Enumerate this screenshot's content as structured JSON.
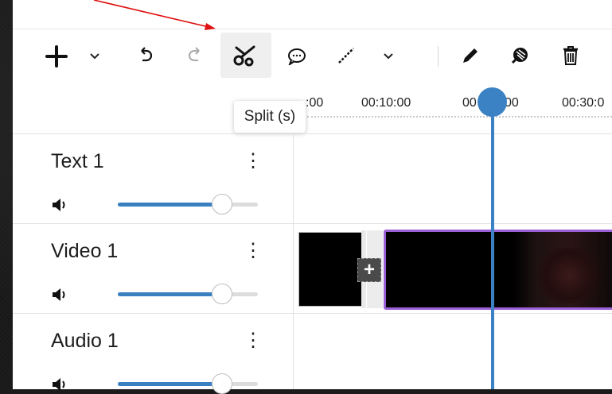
{
  "toolbar": {
    "tools": [
      {
        "name": "add",
        "icon": "plus-icon"
      },
      {
        "name": "add-menu",
        "icon": "chevron-down-icon"
      },
      {
        "name": "undo",
        "icon": "undo-icon"
      },
      {
        "name": "redo",
        "icon": "redo-icon"
      },
      {
        "name": "split",
        "icon": "scissors-icon",
        "active": true
      },
      {
        "name": "comment",
        "icon": "speech-bubble-icon"
      },
      {
        "name": "draw",
        "icon": "wand-icon"
      },
      {
        "name": "draw-menu",
        "icon": "chevron-down-icon"
      },
      {
        "name": "pencil",
        "icon": "pencil-icon"
      },
      {
        "name": "eraser",
        "icon": "eraser-icon"
      },
      {
        "name": "delete",
        "icon": "trash-icon"
      }
    ]
  },
  "tooltip": {
    "text": "Split (s)"
  },
  "ruler": {
    "labels": [
      ":00",
      "00:10:00",
      "00",
      "00",
      "00:30:0"
    ]
  },
  "tracks": [
    {
      "title": "Text 1",
      "volume_fraction": 0.74
    },
    {
      "title": "Video 1",
      "volume_fraction": 0.74
    },
    {
      "title": "Audio 1",
      "volume_fraction": 0.74
    }
  ],
  "colors": {
    "accent_blue": "#3a82c4",
    "clip_selected": "#9b5fd6",
    "annotation_arrow": "#e01010"
  },
  "icons": {
    "speaker": "speaker-icon",
    "kebab": "more-vertical-icon",
    "add_clip": "add-clip-icon"
  },
  "add_clip_symbol": "+",
  "kebab_symbol": "⋮"
}
